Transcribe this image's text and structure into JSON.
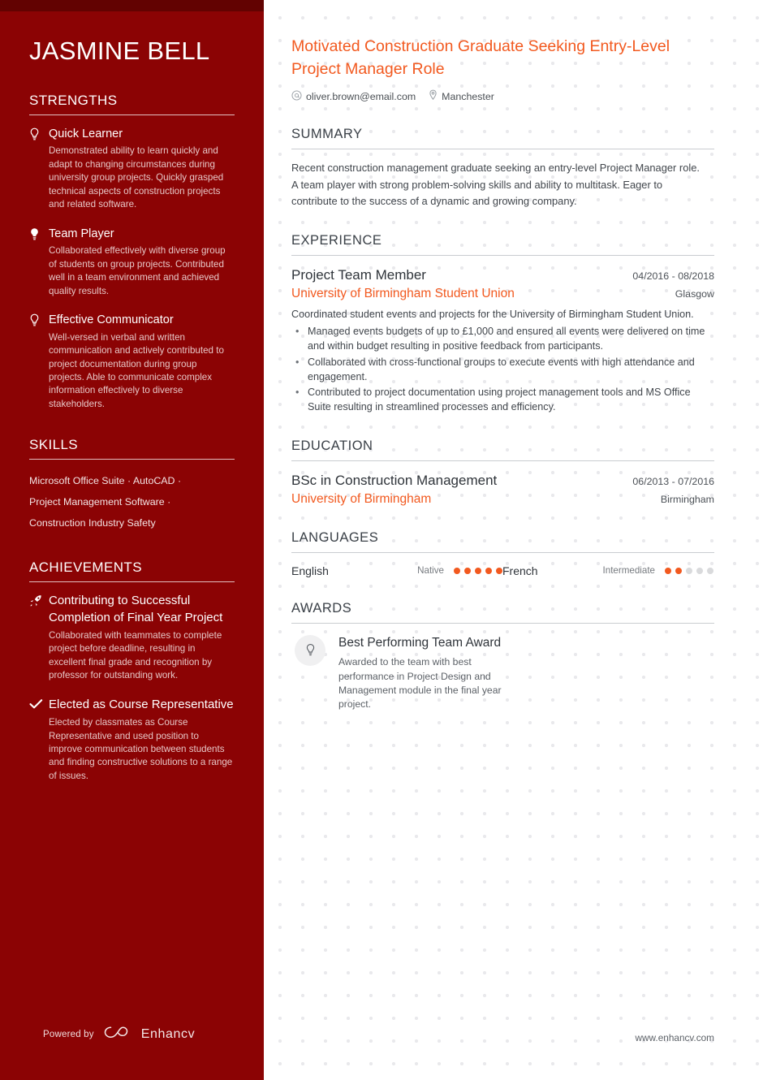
{
  "sidebar": {
    "name": "JASMINE BELL",
    "strengths_heading": "STRENGTHS",
    "strengths": [
      {
        "icon": "lightbulb-outline-icon",
        "title": "Quick Learner",
        "description": "Demonstrated ability to learn quickly and adapt to changing circumstances during university group projects. Quickly grasped technical aspects of construction projects and related software."
      },
      {
        "icon": "lightbulb-filled-icon",
        "title": "Team Player",
        "description": "Collaborated effectively with diverse group of students on group projects. Contributed well in a team environment and achieved quality results."
      },
      {
        "icon": "lightbulb-outline-icon",
        "title": "Effective Communicator",
        "description": "Well-versed in verbal and written communication and actively contributed to project documentation during group projects. Able to communicate complex information effectively to diverse stakeholders."
      }
    ],
    "skills_heading": "SKILLS",
    "skills_lines": [
      "Microsoft Office Suite · AutoCAD ·",
      "Project Management Software ·",
      "Construction Industry Safety"
    ],
    "achievements_heading": "ACHIEVEMENTS",
    "achievements": [
      {
        "icon": "rocket-icon",
        "title": "Contributing to Successful Completion of Final Year Project",
        "description": "Collaborated with teammates to complete project before deadline, resulting in excellent final grade and recognition by professor for outstanding work."
      },
      {
        "icon": "check-icon",
        "title": "Elected as Course Representative",
        "description": "Elected by classmates as Course Representative and used position to improve communication between students and finding constructive solutions to a range of issues."
      }
    ],
    "footer": {
      "powered_by": "Powered by",
      "brand": "Enhancv",
      "logo_icon": "enhancv-logo-icon"
    }
  },
  "main": {
    "headline": "Motivated Construction Graduate Seeking Entry-Level Project Manager Role",
    "contacts": [
      {
        "icon": "at-icon",
        "value": "oliver.brown@email.com"
      },
      {
        "icon": "location-pin-icon",
        "value": "Manchester"
      }
    ],
    "summary": {
      "heading": "SUMMARY",
      "text": "Recent construction management graduate seeking an entry-level Project Manager role. A team player with strong problem-solving skills and ability to multitask. Eager to contribute to the success of a dynamic and growing company."
    },
    "experience": {
      "heading": "EXPERIENCE",
      "entries": [
        {
          "title": "Project Team Member",
          "dates": "04/2016 - 08/2018",
          "organization": "University of Birmingham Student Union",
          "location": "Glasgow",
          "description": "Coordinated student events and projects for the University of Birmingham Student Union.",
          "bullets": [
            "Managed events budgets of up to £1,000 and ensured all events were delivered on time and within budget resulting in positive feedback from participants.",
            "Collaborated with cross-functional groups to execute events with high attendance and engagement.",
            "Contributed to project documentation using project management tools and MS Office Suite resulting in streamlined processes and efficiency."
          ]
        }
      ]
    },
    "education": {
      "heading": "EDUCATION",
      "entries": [
        {
          "title": "BSc in Construction Management",
          "dates": "06/2013 - 07/2016",
          "organization": "University of Birmingham",
          "location": "Birmingham"
        }
      ]
    },
    "languages": {
      "heading": "LANGUAGES",
      "items": [
        {
          "name": "English",
          "level": "Native",
          "filled": 5,
          "total": 5
        },
        {
          "name": "French",
          "level": "Intermediate",
          "filled": 2,
          "total": 5
        }
      ]
    },
    "awards": {
      "heading": "AWARDS",
      "items": [
        {
          "icon": "lightbulb-outline-icon",
          "title": "Best Performing Team Award",
          "description": "Awarded to the team with best performance in Project Design and Management module in the final year project."
        }
      ]
    },
    "website": "www.enhancv.com"
  },
  "colors": {
    "sidebar_bg": "#8b0304",
    "sidebar_top_band": "#620201",
    "accent_orange": "#f2591f",
    "heading_gray": "#3a4047"
  }
}
